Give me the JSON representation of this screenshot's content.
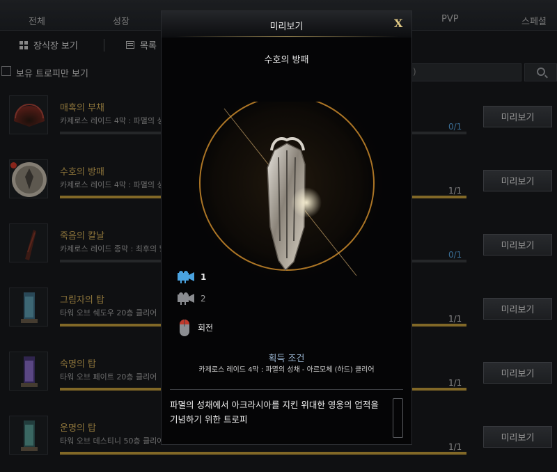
{
  "tabs": [
    {
      "label": "전체"
    },
    {
      "label": "성장"
    },
    {
      "label": "PVP"
    },
    {
      "label": "스페셜"
    }
  ],
  "view": {
    "grid_label": "장식장 보기",
    "list_label": "목록"
  },
  "filter": {
    "owned_only_label": "보유 트로피만 보기",
    "owned_only_checked": false,
    "search_value": ")"
  },
  "list": {
    "items": [
      {
        "title": "매혹의 부채",
        "desc": "카제로스 레이드 4막 : 파멸의 성",
        "count": "0/1",
        "progress": 0,
        "button": "미리보기",
        "count_color": "#5aa9e6"
      },
      {
        "title": "수호의 방패",
        "desc": "카제로스 레이드 4막 : 파멸의 성",
        "count": "1/1",
        "progress": 1,
        "button": "미리보기",
        "count_color": "#cfcfcf"
      },
      {
        "title": "죽음의 칼날",
        "desc": "카제로스 레이드 종막 : 최후의 날",
        "count": "0/1",
        "progress": 0,
        "button": "미리보기",
        "count_color": "#5aa9e6"
      },
      {
        "title": "그림자의 탑",
        "desc": "타워 오브 쉐도우 20층 클리어",
        "count": "1/1",
        "progress": 1,
        "button": "미리보기",
        "count_color": "#cfcfcf"
      },
      {
        "title": "숙명의 탑",
        "desc": "타워 오브 페이트 20층 클리어",
        "count": "1/1",
        "progress": 1,
        "button": "미리보기",
        "count_color": "#cfcfcf"
      },
      {
        "title": "운명의 탑",
        "desc": "타워 오브 데스티니 50층 클리어",
        "count": "1/1",
        "progress": 1,
        "button": "미리보기",
        "count_color": "#cfcfcf"
      }
    ]
  },
  "modal": {
    "title": "미리보기",
    "close": "X",
    "item_name": "수호의 방패",
    "cameras": [
      {
        "label": "1",
        "active": true
      },
      {
        "label": "2",
        "active": false
      }
    ],
    "rotate_label": "회전",
    "condition_title": "획득 조건",
    "condition_desc": "카제로스 레이드 4막 : 파멸의 성채 - 아르모체 (하드) 클리어",
    "description": "파멸의 성채에서 아크라시아를 지킨 위대한 영웅의 업적을 기념하기 위한 트로피"
  }
}
